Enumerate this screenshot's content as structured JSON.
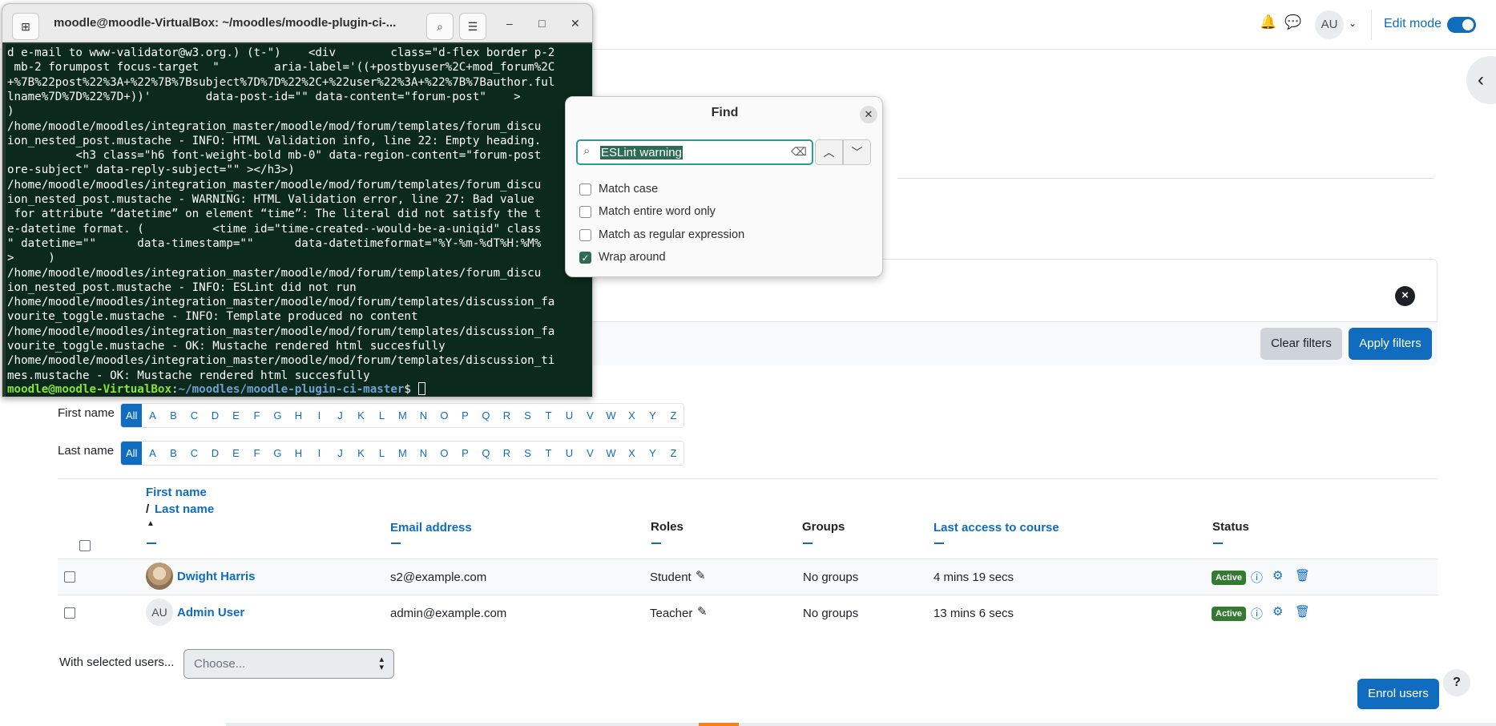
{
  "terminal": {
    "title": "moodle@moodle-VirtualBox: ~/moodles/moodle-plugin-ci-...",
    "lines": [
      "d e-mail to www-validator@w3.org.) (t-\")    <div        class=\"d-flex border p-2",
      " mb-2 forumpost focus-target  \"        aria-label='((+postbyuser%2C+mod_forum%2C",
      "+%7B%22post%22%3A+%22%7B%7Bsubject%7D%7D%22%2C+%22user%22%3A+%22%7B%7Bauthor.ful",
      "lname%7D%7D%22%7D+))'        data-post-id=\"\" data-content=\"forum-post\"    >",
      ")",
      "/home/moodle/moodles/integration_master/moodle/mod/forum/templates/forum_discu",
      "ion_nested_post.mustache - INFO: HTML Validation info, line 22: Empty heading.",
      "          <h3 class=\"h6 font-weight-bold mb-0\" data-region-content=\"forum-post",
      "ore-subject\" data-reply-subject=\"\" ></h3>)",
      "/home/moodle/moodles/integration_master/moodle/mod/forum/templates/forum_discu",
      "ion_nested_post.mustache - WARNING: HTML Validation error, line 27: Bad value",
      " for attribute “datetime” on element “time”: The literal did not satisfy the t",
      "e-datetime format. (          <time id=\"time-created--would-be-a-uniqid\" class",
      "\" datetime=\"\"      data-timestamp=\"\"      data-datetimeformat=\"%Y-%m-%dT%H:%M%",
      ">     )",
      "/home/moodle/moodles/integration_master/moodle/mod/forum/templates/forum_discu",
      "ion_nested_post.mustache - INFO: ESLint did not run",
      "/home/moodle/moodles/integration_master/moodle/mod/forum/templates/discussion_fa",
      "vourite_toggle.mustache - INFO: Template produced no content",
      "/home/moodle/moodles/integration_master/moodle/mod/forum/templates/discussion_fa",
      "vourite_toggle.mustache - OK: Mustache rendered html succesfully",
      "/home/moodle/moodles/integration_master/moodle/mod/forum/templates/discussion_ti",
      "mes.mustache - OK: Mustache rendered html succesfully"
    ],
    "prompt_user": "moodle@moodle-VirtualBox",
    "prompt_sep": ":",
    "prompt_path": "~/moodles/moodle-plugin-ci-master",
    "prompt_end": "$ "
  },
  "find": {
    "title": "Find",
    "query": "ESLint warning",
    "options": [
      {
        "label": "Match case",
        "checked": false
      },
      {
        "label": "Match entire word only",
        "checked": false
      },
      {
        "label": "Match as regular expression",
        "checked": false
      },
      {
        "label": "Wrap around",
        "checked": true
      }
    ]
  },
  "navbar": {
    "avatar_initials": "AU",
    "edit_mode_label": "Edit mode",
    "edit_mode_on": true
  },
  "filters": {
    "clear_label": "Clear filters",
    "apply_label": "Apply filters"
  },
  "initials": {
    "first_name_label": "First name",
    "last_name_label": "Last name",
    "letters": [
      "All",
      "A",
      "B",
      "C",
      "D",
      "E",
      "F",
      "G",
      "H",
      "I",
      "J",
      "K",
      "L",
      "M",
      "N",
      "O",
      "P",
      "Q",
      "R",
      "S",
      "T",
      "U",
      "V",
      "W",
      "X",
      "Y",
      "Z"
    ]
  },
  "table": {
    "headers": {
      "first_name": "First name",
      "slash": "/",
      "last_name": "Last name",
      "email": "Email address",
      "roles": "Roles",
      "groups": "Groups",
      "last_access": "Last access to course",
      "status": "Status"
    },
    "rows": [
      {
        "name": "Dwight Harris",
        "email": "s2@example.com",
        "role": "Student",
        "groups": "No groups",
        "last_access": "4 mins 19 secs",
        "status": "Active",
        "avatar": "photo"
      },
      {
        "name": "Admin User",
        "email": "admin@example.com",
        "role": "Teacher",
        "groups": "No groups",
        "last_access": "13 mins 6 secs",
        "status": "Active",
        "avatar": "AU"
      }
    ]
  },
  "bulk": {
    "label": "With selected users...",
    "placeholder": "Choose..."
  },
  "enrol_label": "Enrol users",
  "help_label": "?"
}
